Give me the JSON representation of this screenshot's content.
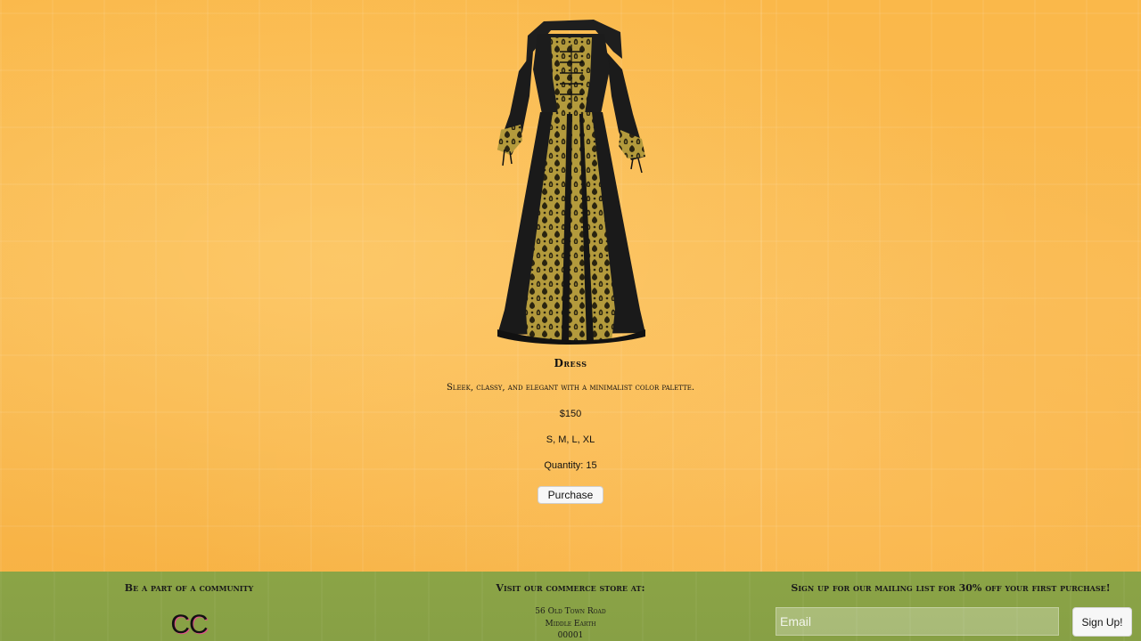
{
  "product": {
    "image_icon": "dress-image",
    "name": "Dress",
    "description": "Sleek, classy, and elegant with a minimalist color palette.",
    "price": "$150",
    "sizes": "S, M, L, XL",
    "quantity": "Quantity: 15",
    "purchase_label": "Purchase"
  },
  "footer": {
    "community": {
      "heading": "Be a part of a community",
      "logo_text": "CC"
    },
    "store": {
      "heading": "Visit our commerce store at:",
      "address_line1": "56 Old Town Road",
      "address_line2": "Middle Earth",
      "address_line3": "00001"
    },
    "mailing": {
      "heading": "Sign up for our mailing list for 30% off your first purchase!",
      "email_placeholder": "Email",
      "signup_label": "Sign Up!"
    }
  },
  "colors": {
    "background": "#f8b444",
    "footer": "#8aa246",
    "dress_black": "#1b1b1b",
    "dress_gold": "#b9a042"
  }
}
